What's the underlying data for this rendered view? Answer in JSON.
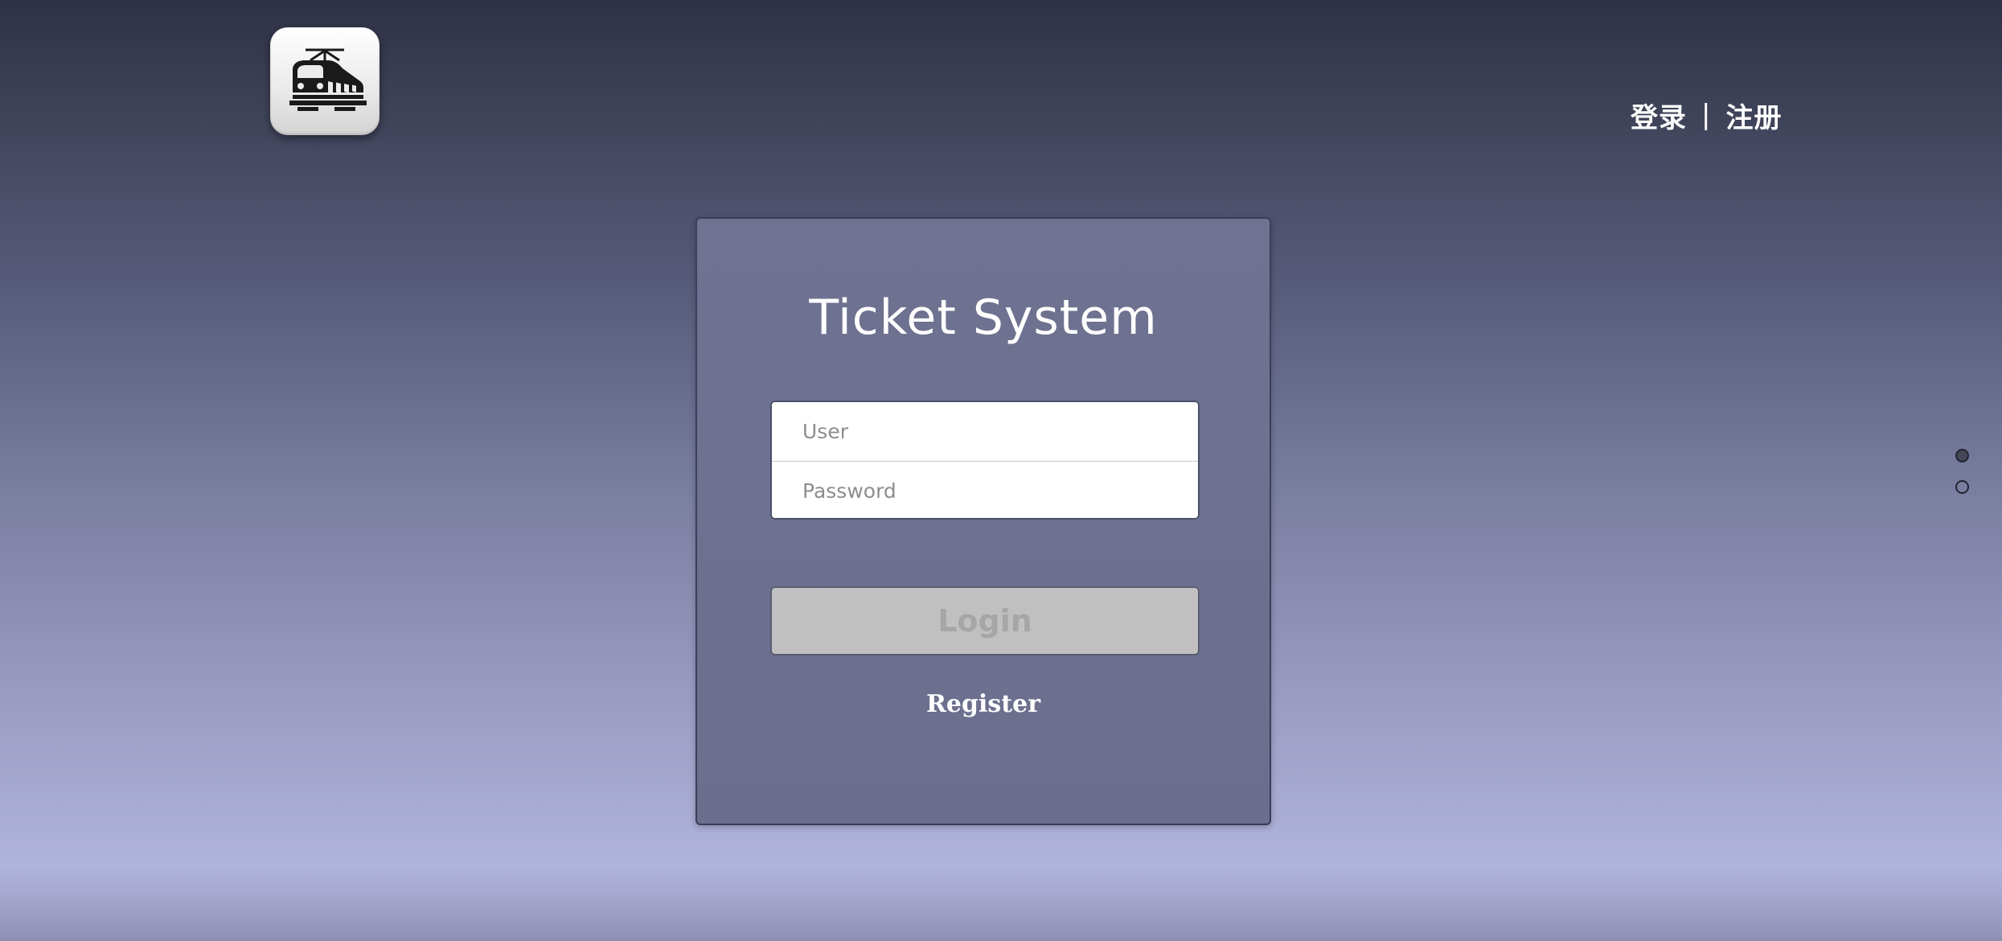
{
  "header": {
    "logo_icon": "train-icon",
    "nav": {
      "login": "登录",
      "separator": "|",
      "register": "注册"
    }
  },
  "card": {
    "title": "Ticket System",
    "user_placeholder": "User",
    "password_placeholder": "Password",
    "login_label": "Login",
    "register_label": "Register"
  },
  "pagination": {
    "count": 2,
    "active_index": 0
  },
  "colors": {
    "background_top": "#2f3246",
    "background_bottom": "#b0b3da",
    "card": "#6f7391",
    "login_button": "#c0c0c0"
  }
}
